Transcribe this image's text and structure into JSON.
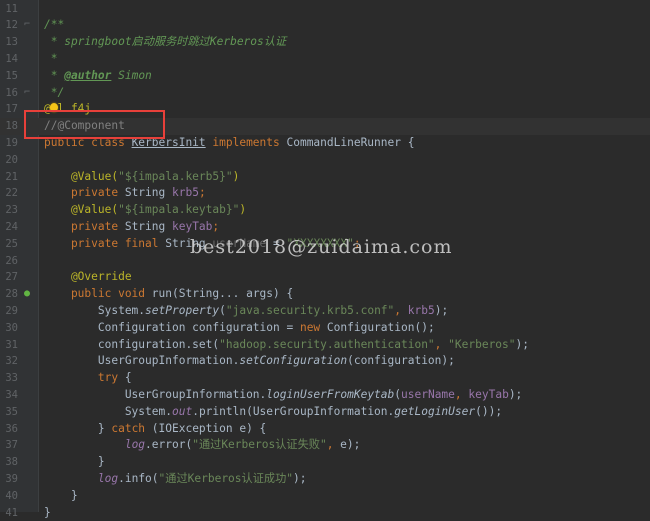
{
  "editor": {
    "watermark": "best2018@zuidaima.com",
    "lines": [
      {
        "n": "11",
        "marker": "",
        "segs": []
      },
      {
        "n": "12",
        "marker": "fold",
        "segs": [
          {
            "t": "/**",
            "c": "t-doc"
          }
        ]
      },
      {
        "n": "13",
        "marker": "",
        "segs": [
          {
            "t": " * springboot启动服务时跳过Kerberos认证",
            "c": "t-doc"
          }
        ]
      },
      {
        "n": "14",
        "marker": "",
        "segs": [
          {
            "t": " *",
            "c": "t-doc"
          }
        ]
      },
      {
        "n": "15",
        "marker": "",
        "segs": [
          {
            "t": " * ",
            "c": "t-doc"
          },
          {
            "t": "@author",
            "c": "t-doctag"
          },
          {
            "t": " Simon",
            "c": "t-doc"
          }
        ]
      },
      {
        "n": "16",
        "marker": "fold",
        "segs": [
          {
            "t": " */",
            "c": "t-doc"
          }
        ]
      },
      {
        "n": "17",
        "marker": "",
        "segs": [
          {
            "t": "@Sl f4j",
            "c": "t-ann"
          }
        ]
      },
      {
        "n": "18",
        "marker": "",
        "segs": [
          {
            "t": "//@Component",
            "c": "t-com"
          }
        ]
      },
      {
        "n": "19",
        "marker": "",
        "segs": [
          {
            "t": "public class ",
            "c": "t-kw"
          },
          {
            "t": "KerbersInit",
            "c": "t-plain t-under"
          },
          {
            "t": " implements ",
            "c": "t-kw"
          },
          {
            "t": "CommandLineRunner {",
            "c": "t-plain"
          }
        ]
      },
      {
        "n": "20",
        "marker": "",
        "segs": []
      },
      {
        "n": "21",
        "marker": "",
        "segs": [
          {
            "t": "    @Value(",
            "c": "t-ann"
          },
          {
            "t": "\"${impala.kerb5}\"",
            "c": "t-str"
          },
          {
            "t": ")",
            "c": "t-ann"
          }
        ]
      },
      {
        "n": "22",
        "marker": "",
        "segs": [
          {
            "t": "    private ",
            "c": "t-kw"
          },
          {
            "t": "String ",
            "c": "t-plain"
          },
          {
            "t": "krb5",
            "c": "t-fld"
          },
          {
            "t": ";",
            "c": "t-kw"
          }
        ]
      },
      {
        "n": "23",
        "marker": "",
        "segs": [
          {
            "t": "    @Value(",
            "c": "t-ann"
          },
          {
            "t": "\"${impala.keytab}\"",
            "c": "t-str"
          },
          {
            "t": ")",
            "c": "t-ann"
          }
        ]
      },
      {
        "n": "24",
        "marker": "",
        "segs": [
          {
            "t": "    private ",
            "c": "t-kw"
          },
          {
            "t": "String ",
            "c": "t-plain"
          },
          {
            "t": "keyTab",
            "c": "t-fld"
          },
          {
            "t": ";",
            "c": "t-kw"
          }
        ]
      },
      {
        "n": "25",
        "marker": "",
        "segs": [
          {
            "t": "    private final ",
            "c": "t-kw"
          },
          {
            "t": "String ",
            "c": "t-plain"
          },
          {
            "t": "userName",
            "c": "t-dim"
          },
          {
            "t": " = ",
            "c": "t-plain"
          },
          {
            "t": "\"XXXXXXXX\"",
            "c": "t-str"
          },
          {
            "t": ";",
            "c": "t-kw"
          }
        ]
      },
      {
        "n": "26",
        "marker": "",
        "segs": []
      },
      {
        "n": "27",
        "marker": "",
        "segs": [
          {
            "t": "    @Override",
            "c": "t-ann"
          }
        ]
      },
      {
        "n": "28",
        "marker": "run",
        "segs": [
          {
            "t": "    public void ",
            "c": "t-kw"
          },
          {
            "t": "run",
            "c": "t-plain"
          },
          {
            "t": "(String... args) {",
            "c": "t-plain"
          }
        ]
      },
      {
        "n": "29",
        "marker": "",
        "segs": [
          {
            "t": "        System.",
            "c": "t-plain"
          },
          {
            "t": "setProperty",
            "c": "t-plain t-ital"
          },
          {
            "t": "(",
            "c": "t-plain"
          },
          {
            "t": "\"java.security.krb5.conf\"",
            "c": "t-str"
          },
          {
            "t": ", ",
            "c": "t-kw"
          },
          {
            "t": "krb5",
            "c": "t-fld"
          },
          {
            "t": ");",
            "c": "t-plain"
          }
        ]
      },
      {
        "n": "30",
        "marker": "",
        "segs": [
          {
            "t": "        Configuration configuration = ",
            "c": "t-plain"
          },
          {
            "t": "new ",
            "c": "t-kw"
          },
          {
            "t": "Configuration();",
            "c": "t-plain"
          }
        ]
      },
      {
        "n": "31",
        "marker": "",
        "segs": [
          {
            "t": "        configuration.set(",
            "c": "t-plain"
          },
          {
            "t": "\"hadoop.security.authentication\"",
            "c": "t-str"
          },
          {
            "t": ", ",
            "c": "t-kw"
          },
          {
            "t": "\"Kerberos\"",
            "c": "t-str"
          },
          {
            "t": ");",
            "c": "t-plain"
          }
        ]
      },
      {
        "n": "32",
        "marker": "",
        "segs": [
          {
            "t": "        UserGroupInformation.",
            "c": "t-plain"
          },
          {
            "t": "setConfiguration",
            "c": "t-plain t-ital"
          },
          {
            "t": "(configuration);",
            "c": "t-plain"
          }
        ]
      },
      {
        "n": "33",
        "marker": "",
        "segs": [
          {
            "t": "        try ",
            "c": "t-kw"
          },
          {
            "t": "{",
            "c": "t-plain"
          }
        ]
      },
      {
        "n": "34",
        "marker": "",
        "segs": [
          {
            "t": "            UserGroupInformation.",
            "c": "t-plain"
          },
          {
            "t": "loginUserFromKeytab",
            "c": "t-plain t-ital"
          },
          {
            "t": "(",
            "c": "t-plain"
          },
          {
            "t": "userName",
            "c": "t-fld"
          },
          {
            "t": ", ",
            "c": "t-kw"
          },
          {
            "t": "keyTab",
            "c": "t-fld"
          },
          {
            "t": ");",
            "c": "t-plain"
          }
        ]
      },
      {
        "n": "35",
        "marker": "",
        "segs": [
          {
            "t": "            System.",
            "c": "t-plain"
          },
          {
            "t": "out",
            "c": "t-fldi"
          },
          {
            "t": ".println(UserGroupInformation.",
            "c": "t-plain"
          },
          {
            "t": "getLoginUser",
            "c": "t-plain t-ital"
          },
          {
            "t": "());",
            "c": "t-plain"
          }
        ]
      },
      {
        "n": "36",
        "marker": "",
        "segs": [
          {
            "t": "        } ",
            "c": "t-plain"
          },
          {
            "t": "catch ",
            "c": "t-kw"
          },
          {
            "t": "(IOException e) {",
            "c": "t-plain"
          }
        ]
      },
      {
        "n": "37",
        "marker": "",
        "segs": [
          {
            "t": "            ",
            "c": "t-plain"
          },
          {
            "t": "log",
            "c": "t-fldi"
          },
          {
            "t": ".error(",
            "c": "t-plain"
          },
          {
            "t": "\"通过Kerberos认证失败\"",
            "c": "t-str"
          },
          {
            "t": ", ",
            "c": "t-kw"
          },
          {
            "t": "e);",
            "c": "t-plain"
          }
        ]
      },
      {
        "n": "38",
        "marker": "",
        "segs": [
          {
            "t": "        }",
            "c": "t-plain"
          }
        ]
      },
      {
        "n": "39",
        "marker": "",
        "segs": [
          {
            "t": "        ",
            "c": "t-plain"
          },
          {
            "t": "log",
            "c": "t-fldi"
          },
          {
            "t": ".info(",
            "c": "t-plain"
          },
          {
            "t": "\"通过Kerberos认证成功\"",
            "c": "t-str"
          },
          {
            "t": ");",
            "c": "t-plain"
          }
        ]
      },
      {
        "n": "40",
        "marker": "",
        "segs": [
          {
            "t": "    }",
            "c": "t-plain"
          }
        ]
      },
      {
        "n": "41",
        "marker": "",
        "segs": [
          {
            "t": "}",
            "c": "t-plain"
          }
        ]
      }
    ],
    "current_line": "18"
  }
}
